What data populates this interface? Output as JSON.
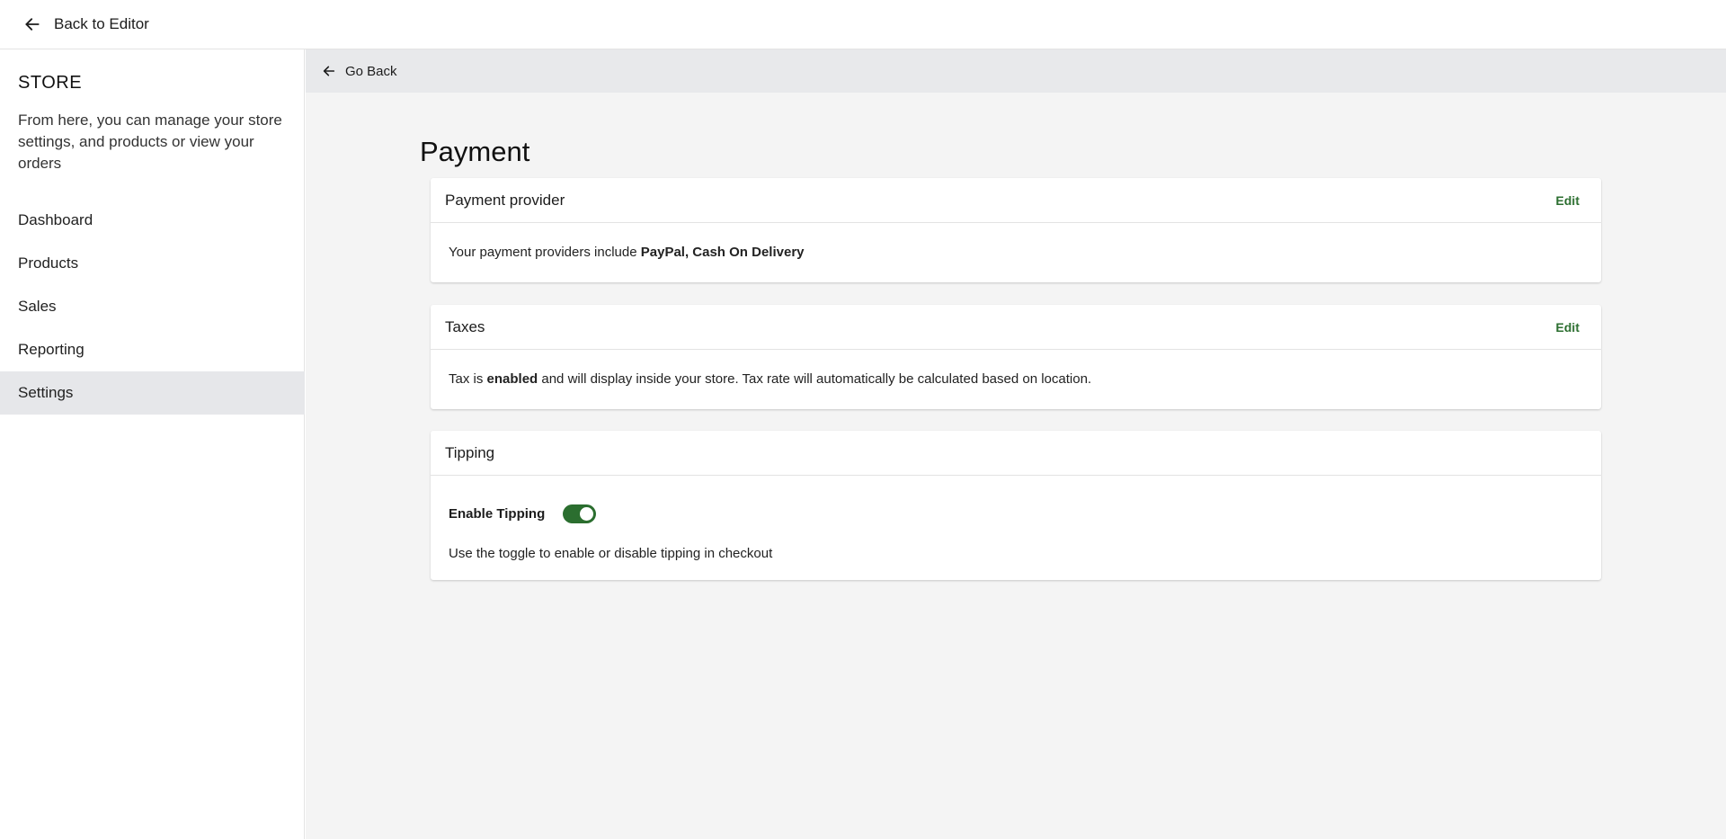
{
  "topbar": {
    "back_label": "Back to Editor"
  },
  "sidebar": {
    "title": "STORE",
    "description": "From here, you can manage your store settings, and products or view your orders",
    "items": [
      {
        "label": "Dashboard"
      },
      {
        "label": "Products"
      },
      {
        "label": "Sales"
      },
      {
        "label": "Reporting"
      },
      {
        "label": "Settings",
        "active": true
      }
    ]
  },
  "main": {
    "go_back_label": "Go Back",
    "page_title": "Payment",
    "payment_provider": {
      "title": "Payment provider",
      "edit_label": "Edit",
      "text_prefix": "Your payment providers include ",
      "providers": "PayPal, Cash On Delivery"
    },
    "taxes": {
      "title": "Taxes",
      "edit_label": "Edit",
      "text_prefix": "Tax is ",
      "status": "enabled",
      "text_suffix": " and will display inside your store. Tax rate will automatically be calculated based on location."
    },
    "tipping": {
      "title": "Tipping",
      "toggle_label": "Enable Tipping",
      "enabled": true,
      "help_text": "Use the toggle to enable or disable tipping in checkout"
    }
  },
  "colors": {
    "accent": "#2b6e2f",
    "sidebar_active": "#e6e7ea",
    "main_bg": "#f4f4f4",
    "gobar_bg": "#e8e9eb"
  }
}
